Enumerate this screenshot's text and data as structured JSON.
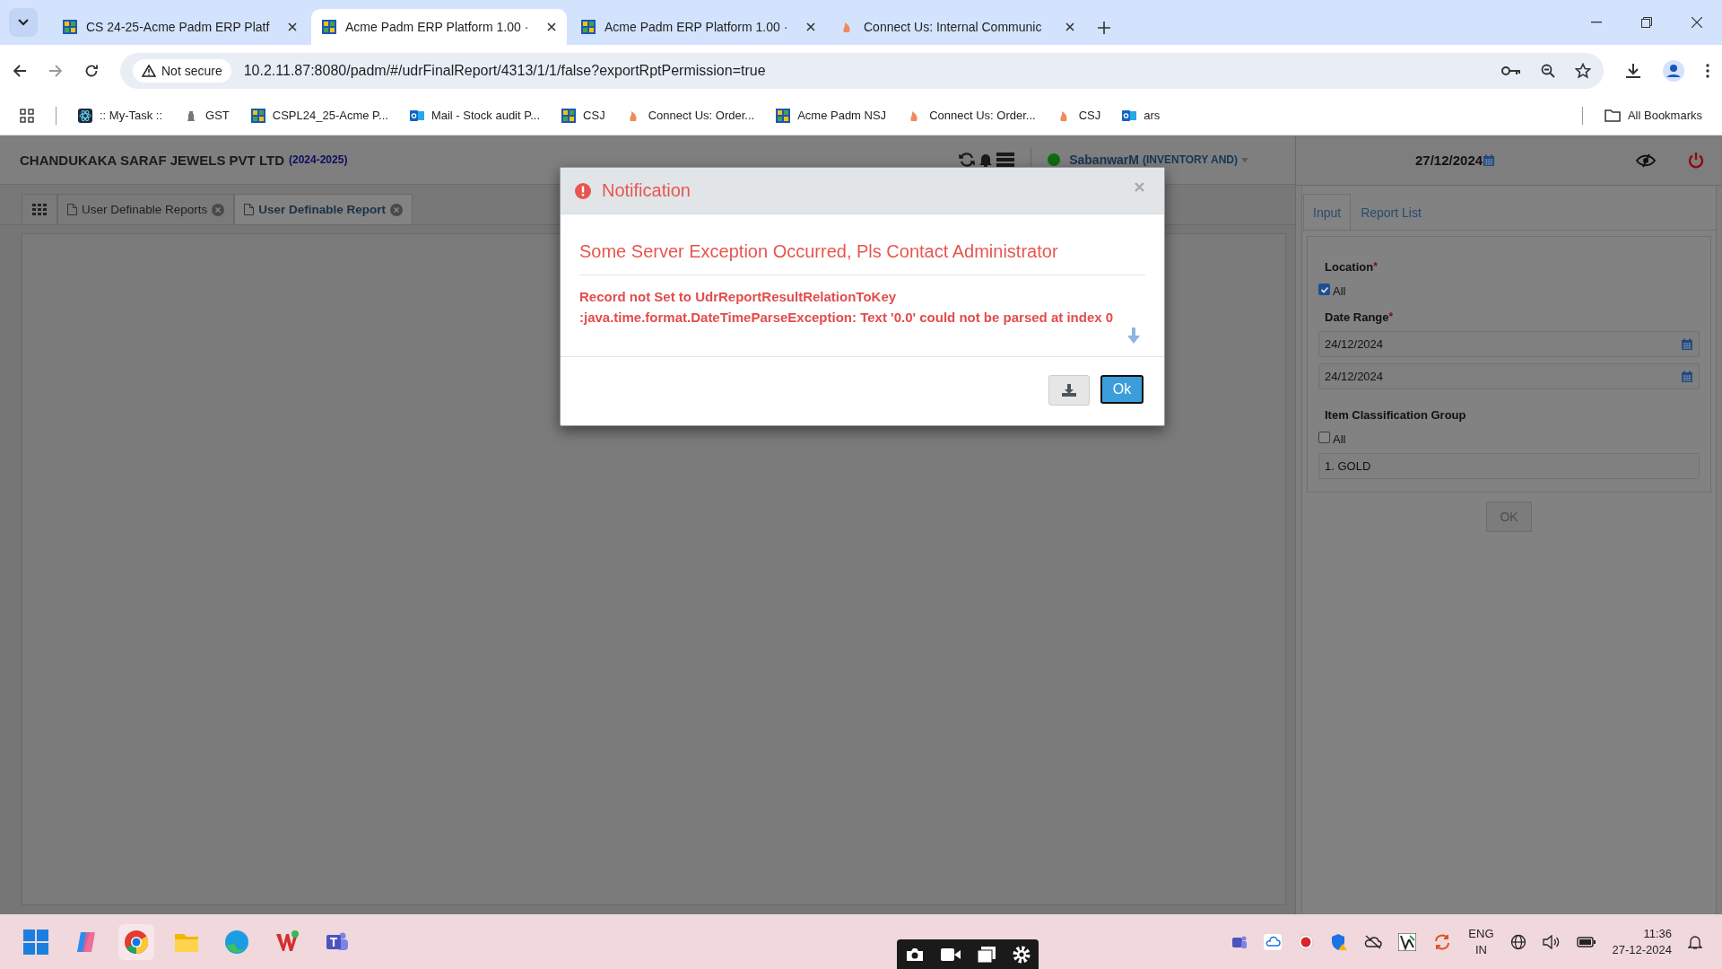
{
  "browser": {
    "tabs": [
      {
        "title": "CS 24-25-Acme Padm ERP Platf",
        "selected": false,
        "kind": "erp"
      },
      {
        "title": "Acme Padm ERP Platform 1.00 ·",
        "selected": true,
        "kind": "erp"
      },
      {
        "title": "Acme Padm ERP Platform 1.00 ·",
        "selected": false,
        "kind": "erp"
      },
      {
        "title": "Connect Us: Internal Communic",
        "selected": false,
        "kind": "connect"
      }
    ],
    "security_label": "Not secure",
    "url": "10.2.11.87:8080/padm/#/udrFinalReport/4313/1/1/false?exportRptPermission=true",
    "bookmarks": [
      {
        "label": ":: My-Task ::",
        "kind": "atom"
      },
      {
        "label": "GST",
        "kind": "emblem"
      },
      {
        "label": "CSPL24_25-Acme P...",
        "kind": "erp"
      },
      {
        "label": "Mail - Stock audit P...",
        "kind": "mail"
      },
      {
        "label": "CSJ",
        "kind": "erp"
      },
      {
        "label": "Connect Us: Order...",
        "kind": "connect"
      },
      {
        "label": "Acme Padm NSJ",
        "kind": "erp"
      },
      {
        "label": "Connect Us: Order...",
        "kind": "connect"
      },
      {
        "label": "CSJ",
        "kind": "connect"
      },
      {
        "label": "ars",
        "kind": "mail"
      }
    ],
    "all_bookmarks": "All Bookmarks"
  },
  "app": {
    "company": "CHANDUKAKA SARAF JEWELS PVT LTD",
    "year": "(2024-2025)",
    "user": "SabanwarM",
    "role": "(INVENTORY AND)",
    "date": "27/12/2024",
    "page_tabs": [
      {
        "label": "User Definable Reports",
        "selected": false
      },
      {
        "label": "User Definable Report",
        "selected": true
      }
    ],
    "panel_tabs": [
      {
        "label": "Input",
        "selected": true
      },
      {
        "label": "Report List",
        "selected": false
      }
    ],
    "location": {
      "label": "Location",
      "required_mark": "*",
      "all_label": "All",
      "checked": true
    },
    "date_range": {
      "label": "Date Range",
      "required_mark": "*",
      "from": "24/12/2024",
      "to": "24/12/2024"
    },
    "item_group": {
      "label": "Item Classification Group",
      "all_label": "All",
      "checked": false,
      "value": "1. GOLD"
    },
    "ok_button": "OK"
  },
  "dialog": {
    "title": "Notification",
    "message": "Some Server Exception Occurred, Pls Contact Administrator",
    "detail_lines": [
      "Record not Set to UdrReportResultRelationToKey",
      ":java.time.format.DateTimeParseException: Text '0.0' could not be parsed at index 0"
    ],
    "ok_button": "Ok"
  },
  "taskbar": {
    "language": "ENG",
    "region": "IN",
    "time": "11:36",
    "date": "27-12-2024"
  }
}
